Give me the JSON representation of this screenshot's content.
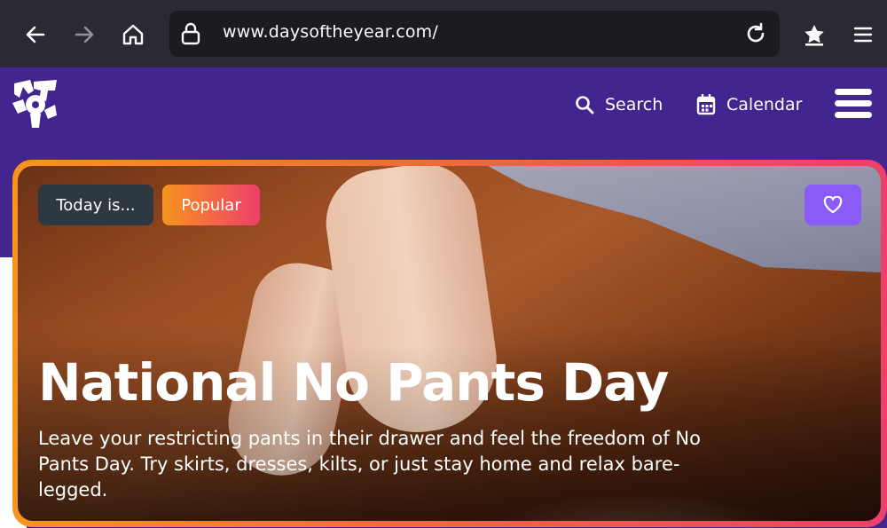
{
  "browser": {
    "url": "www.daysoftheyear.com/",
    "back_icon": "arrow-left-icon",
    "forward_icon": "arrow-right-icon",
    "home_icon": "home-icon",
    "lock_icon": "lock-icon",
    "reload_icon": "reload-icon",
    "bookmark_icon": "star-bookmark-icon",
    "menu_icon": "hamburger-menu-icon"
  },
  "header": {
    "logo_icon": "dot-logo-icon",
    "search_label": "Search",
    "calendar_label": "Calendar",
    "menu_icon": "hamburger-menu-icon",
    "brand_color": "#43258f"
  },
  "hero": {
    "badge_today": "Today is...",
    "badge_popular": "Popular",
    "favorite_icon": "heart-icon",
    "title": "National No Pants Day",
    "description": "Leave your restricting pants in their drawer and feel the freedom of No Pants Day. Try skirts, dresses, kilts, or just stay home and relax bare-legged.",
    "accent_gradient": [
      "#f7941d",
      "#ee3f6c"
    ],
    "favorite_color": "#8a5cf5"
  }
}
